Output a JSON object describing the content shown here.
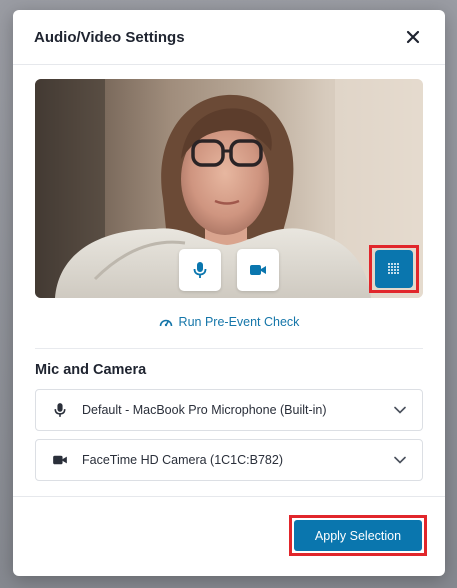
{
  "modal": {
    "title": "Audio/Video Settings",
    "close_icon": "close-icon"
  },
  "preview": {
    "mic_icon": "microphone-icon",
    "camera_icon": "video-camera-icon",
    "blur_icon": "background-blur-icon"
  },
  "precheck": {
    "label": "Run Pre-Event Check",
    "icon": "speedometer-icon"
  },
  "devices": {
    "section_title": "Mic and Camera",
    "microphone": {
      "selected": "Default - MacBook Pro Microphone (Built-in)",
      "icon": "microphone-icon"
    },
    "camera": {
      "selected": "FaceTime HD Camera (1C1C:B782)",
      "icon": "video-camera-icon"
    }
  },
  "footer": {
    "apply_label": "Apply Selection"
  },
  "colors": {
    "accent": "#0a76ae",
    "highlight": "#e1262b",
    "link": "#1576a9"
  }
}
